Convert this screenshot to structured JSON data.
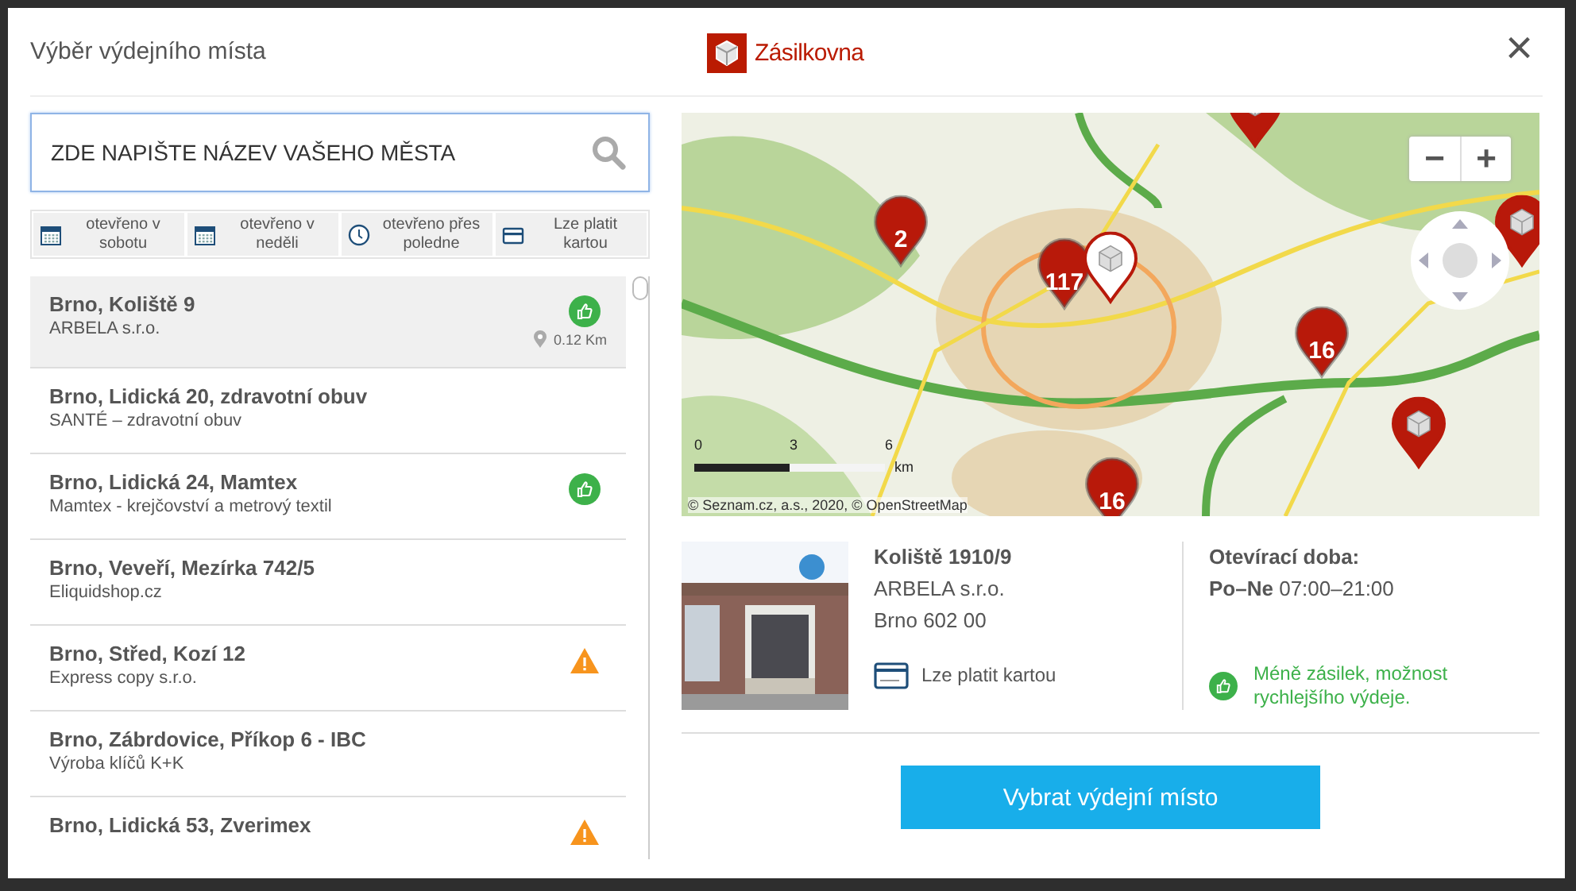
{
  "dialog": {
    "title": "Výběr výdejního místa",
    "brand": "Zásilkovna",
    "close": "×"
  },
  "search": {
    "value": "ZDE NAPIŠTE NÁZEV VAŠEHO MĚSTA"
  },
  "filters": [
    {
      "kind": "calendar",
      "label": "otevřeno v sobotu",
      "selected": false
    },
    {
      "kind": "calendar",
      "label": "otevřeno v neděli",
      "selected": false
    },
    {
      "kind": "clock",
      "label": "otevřeno přes poledne",
      "selected": false
    },
    {
      "kind": "card",
      "label": "Lze platit kartou",
      "selected": false
    }
  ],
  "places": [
    {
      "title": "Brno, Koliště 9",
      "subtitle": "ARBELA s.r.o.",
      "kind": "like",
      "distance": "0.12 Km",
      "selected": true
    },
    {
      "title": "Brno, Lidická 20, zdravotní obuv",
      "subtitle": "SANTÉ – zdravotní obuv",
      "kind": "plain",
      "selected": false
    },
    {
      "title": "Brno, Lidická 24, Mamtex",
      "subtitle": "Mamtex - krejčovství a metrový textil",
      "kind": "like",
      "selected": false
    },
    {
      "title": "Brno, Veveří, Mezírka 742/5",
      "subtitle": "Eliquidshop.cz",
      "kind": "plain",
      "selected": false
    },
    {
      "title": "Brno, Střed, Kozí 12",
      "subtitle": "Express copy s.r.o.",
      "kind": "warning",
      "selected": false
    },
    {
      "title": "Brno, Zábrdovice, Příkop 6 - IBC",
      "subtitle": "Výroba klíčů K+K",
      "kind": "plain",
      "selected": false
    },
    {
      "title": "Brno, Lidická 53, Zverimex",
      "kind": "warning",
      "selected": false
    }
  ],
  "map": {
    "markers": [
      {
        "kind": "cluster",
        "count": "2"
      },
      {
        "kind": "cluster",
        "count": "117"
      },
      {
        "kind": "selected"
      },
      {
        "kind": "cluster",
        "count": "16"
      },
      {
        "kind": "cluster",
        "count": "16"
      },
      {
        "kind": "pin"
      },
      {
        "kind": "pin"
      },
      {
        "kind": "pin"
      }
    ],
    "zoom_out": "−",
    "zoom_in": "+",
    "scale": [
      "0",
      "3",
      "6"
    ],
    "scale_unit": "km",
    "attribution": "© Seznam.cz, a.s., 2020, © OpenStreetMap"
  },
  "detail": {
    "street": "Koliště 1910/9",
    "company": "ARBELA s.r.o.",
    "city": "Brno 602 00",
    "payment": "Lze platit kartou",
    "hours_title": "Otevírací doba:",
    "days": "Po–Ne",
    "hours": "07:00–21:00",
    "note": "Méně zásilek, možnost rychlejšího výdeje."
  },
  "action": "Vybrat výdejní místo"
}
